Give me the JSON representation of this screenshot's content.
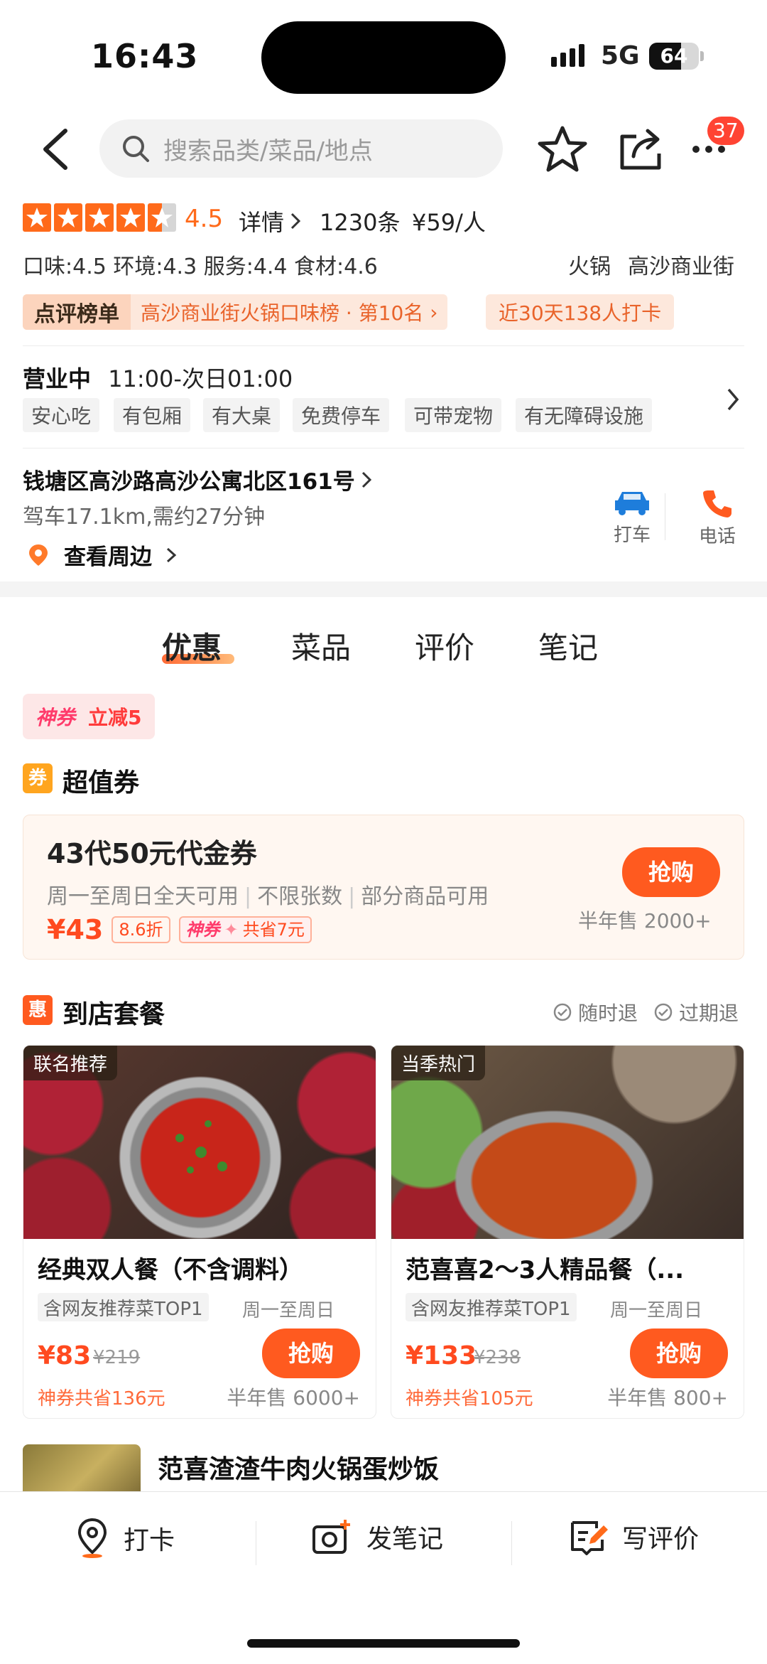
{
  "status": {
    "time": "16:43",
    "network": "5G",
    "battery": "64",
    "battery_level": 0.64
  },
  "nav": {
    "search_placeholder": "搜索品类/菜品/地点",
    "badge": "37"
  },
  "rating": {
    "score": "4.5",
    "stars": 4.5,
    "detail_link": "详情",
    "reviews": "1230条",
    "price": "¥59/人",
    "sub_scores": "口味:4.5  环境:4.3  服务:4.4  食材:4.6",
    "category": "火锅",
    "area": "高沙商业街"
  },
  "rank": {
    "label": "点评榜单",
    "text": "高沙商业街火锅口味榜 · 第10名",
    "checkin": "近30天138人打卡"
  },
  "hours": {
    "status": "营业中",
    "time": "11:00-次日01:00"
  },
  "facilities": [
    "安心吃",
    "有包厢",
    "有大桌",
    "免费停车",
    "可带宠物",
    "有无障碍设施"
  ],
  "address": {
    "line": "钱塘区高沙路高沙公寓北区161号",
    "distance": "驾车17.1km,需约27分钟",
    "nearby": "查看周边",
    "taxi": "打车",
    "phone": "电话"
  },
  "tabs": [
    "优惠",
    "菜品",
    "评价",
    "笔记"
  ],
  "shenquan": {
    "brand": "神券",
    "offer": "立减5"
  },
  "value_coupon": {
    "icon": "券",
    "title": "超值券",
    "card_title": "43代50元代金券",
    "desc": [
      "周一至周日全天可用",
      "不限张数",
      "部分商品可用"
    ],
    "price": "¥43",
    "discount": "8.6折",
    "shenquan": "神券",
    "save": "共省7元",
    "buy": "抢购",
    "sold": "半年售 2000+"
  },
  "packages": {
    "icon": "惠",
    "title": "到店套餐",
    "refund1": "随时退",
    "refund2": "过期退",
    "items": [
      {
        "tag": "联名推荐",
        "name": "经典双人餐（不含调料）",
        "tag2": "含网友推荐菜TOP1",
        "days": "周一至周日",
        "price": "¥83",
        "orig": "¥219",
        "save": "神券共省136元",
        "sold": "半年售 6000+",
        "buy": "抢购"
      },
      {
        "tag": "当季热门",
        "name": "范喜喜2～3人精品餐（...",
        "tag2": "含网友推荐菜TOP1",
        "days": "周一至周日",
        "price": "¥133",
        "orig": "¥238",
        "save": "神券共省105元",
        "sold": "半年售 800+",
        "buy": "抢购"
      }
    ],
    "third_item": "范喜渣渣牛肉火锅蛋炒饭"
  },
  "bottom": {
    "checkin": "打卡",
    "post_note": "发笔记",
    "write_review": "写评价"
  },
  "colors": {
    "accent": "#ff5a1f",
    "star": "#ff6a1a",
    "taxi": "#1e7ddb"
  }
}
